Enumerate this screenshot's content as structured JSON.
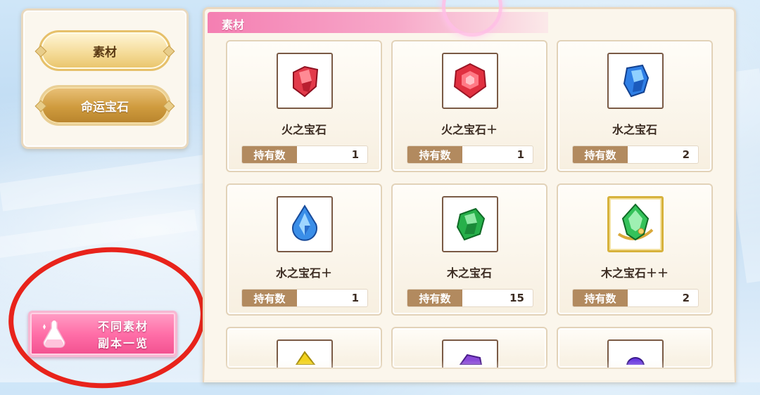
{
  "sidebar": {
    "tabs": [
      {
        "label": "素材",
        "active": true
      },
      {
        "label": "命运宝石",
        "active": false
      }
    ]
  },
  "dungeon_button": {
    "line1": "不同素材",
    "line2": "副本一览"
  },
  "panel": {
    "title": "素材"
  },
  "count_label": "持有数",
  "items": [
    {
      "name": "火之宝石",
      "count": "1",
      "icon": "red-gem-icon"
    },
    {
      "name": "火之宝石＋",
      "count": "1",
      "icon": "red-hex-gem-icon"
    },
    {
      "name": "水之宝石",
      "count": "2",
      "icon": "blue-gem-icon"
    },
    {
      "name": "水之宝石＋",
      "count": "1",
      "icon": "blue-drop-gem-icon"
    },
    {
      "name": "木之宝石",
      "count": "15",
      "icon": "green-gem-icon"
    },
    {
      "name": "木之宝石＋＋",
      "count": "2",
      "icon": "green-gem-gold-icon"
    }
  ],
  "colors": {
    "accent_pink": "#f47fb2",
    "tab_gold": "#cf9b3e",
    "annotation_red": "#e8231b"
  }
}
